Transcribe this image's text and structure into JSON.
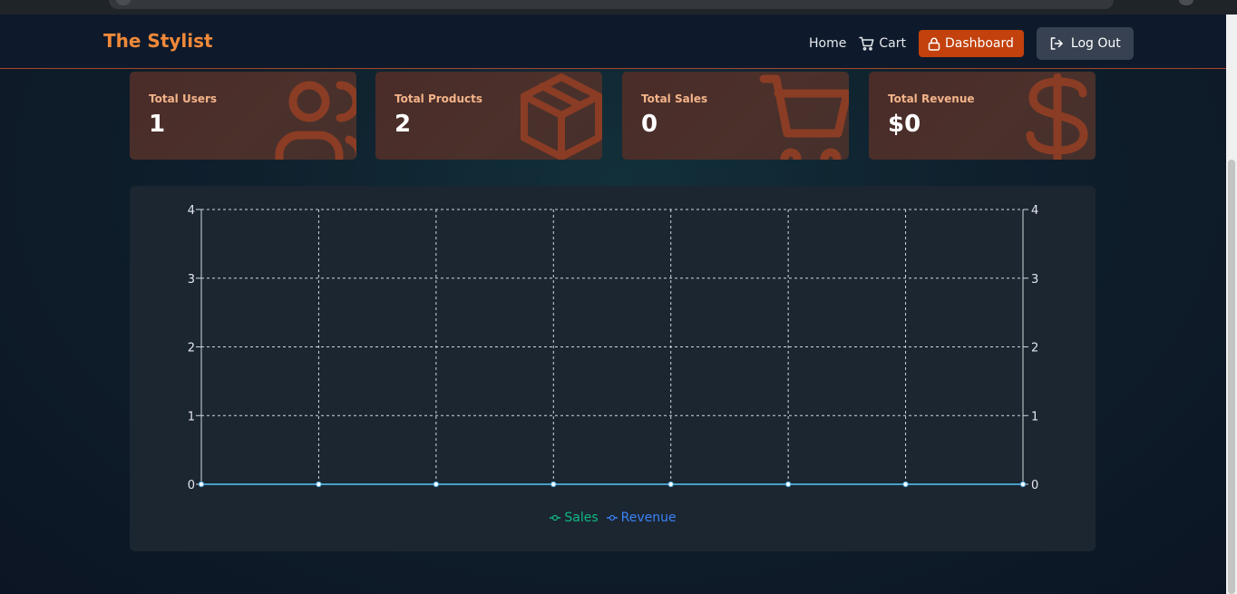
{
  "brand": "The Stylist",
  "nav": {
    "home": "Home",
    "cart": "Cart",
    "dashboard": "Dashboard",
    "logout": "Log Out"
  },
  "stats": [
    {
      "label": "Total Users",
      "value": "1",
      "icon": "users-icon"
    },
    {
      "label": "Total Products",
      "value": "2",
      "icon": "package-icon"
    },
    {
      "label": "Total Sales",
      "value": "0",
      "icon": "cart-icon"
    },
    {
      "label": "Total Revenue",
      "value": "$0",
      "icon": "dollar-icon"
    }
  ],
  "colors": {
    "accent": "#c2410c",
    "brand": "#f0893a",
    "sales": "#10b981",
    "revenue": "#3b82f6"
  },
  "chart_data": {
    "type": "line",
    "x": [
      "",
      "",
      "",
      "",
      "",
      "",
      "",
      ""
    ],
    "series": [
      {
        "name": "Sales",
        "axis": "left",
        "values": [
          0,
          0,
          0,
          0,
          0,
          0,
          0,
          0
        ]
      },
      {
        "name": "Revenue",
        "axis": "right",
        "values": [
          0,
          0,
          0,
          0,
          0,
          0,
          0,
          0
        ]
      }
    ],
    "ylim": [
      0,
      4
    ],
    "yticks": [
      "0",
      "1",
      "2",
      "3",
      "4"
    ],
    "y2ticks": [
      "0",
      "1",
      "2",
      "3",
      "4"
    ],
    "grid": true,
    "legend": "bottom-center"
  }
}
